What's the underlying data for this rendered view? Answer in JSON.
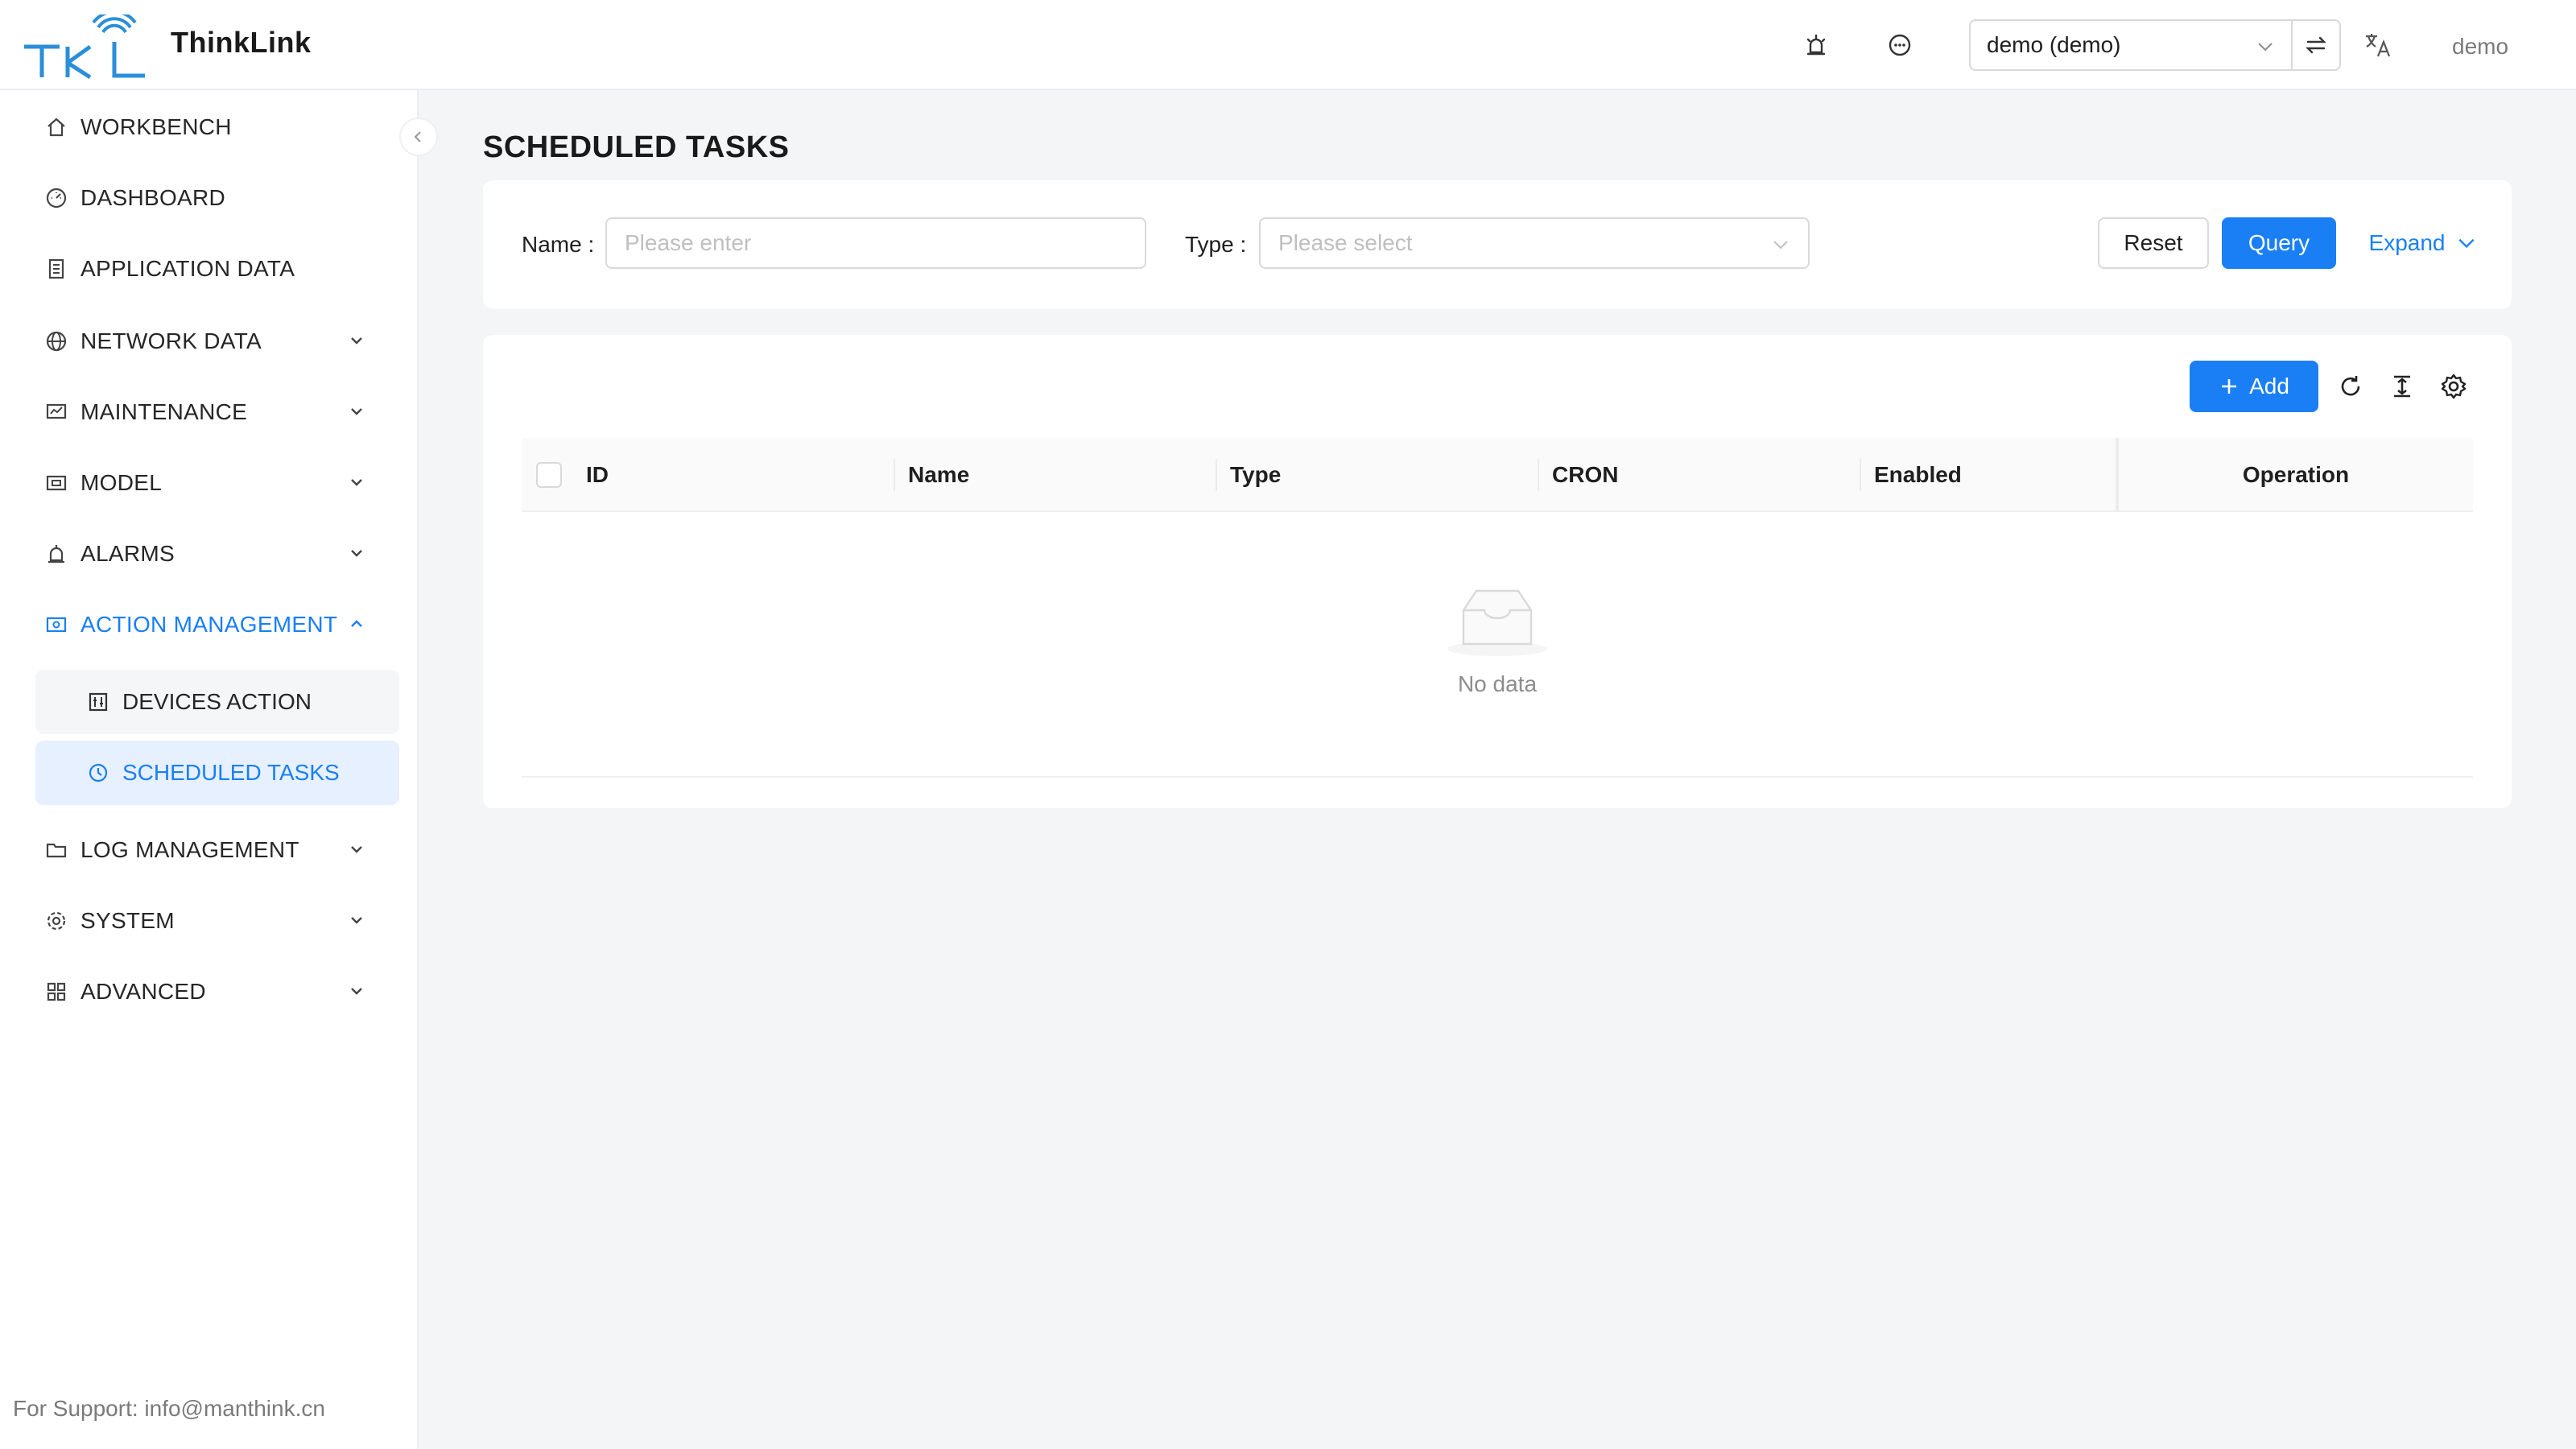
{
  "app": {
    "title": "ThinkLink",
    "user": "demo",
    "tenant": "demo (demo)",
    "support": "For Support: info@manthink.cn",
    "accent_color": "#1a7ff5"
  },
  "header": {
    "icons": [
      "alarm-icon",
      "message-icon",
      "switch-icon",
      "translate-icon"
    ]
  },
  "sidebar": {
    "items": [
      {
        "label": "WORKBENCH",
        "icon": "home-icon",
        "expandable": false
      },
      {
        "label": "DASHBOARD",
        "icon": "dashboard-icon",
        "expandable": false
      },
      {
        "label": "APPLICATION DATA",
        "icon": "document-icon",
        "expandable": false
      },
      {
        "label": "NETWORK DATA",
        "icon": "globe-icon",
        "expandable": true
      },
      {
        "label": "MAINTENANCE",
        "icon": "maintenance-icon",
        "expandable": true
      },
      {
        "label": "MODEL",
        "icon": "model-icon",
        "expandable": true
      },
      {
        "label": "ALARMS",
        "icon": "alarm-icon",
        "expandable": true
      },
      {
        "label": "ACTION MANAGEMENT",
        "icon": "action-icon",
        "expandable": true,
        "expanded": true
      },
      {
        "label": "LOG MANAGEMENT",
        "icon": "folder-icon",
        "expandable": true
      },
      {
        "label": "SYSTEM",
        "icon": "gear-icon",
        "expandable": true
      },
      {
        "label": "ADVANCED",
        "icon": "advanced-icon",
        "expandable": true
      }
    ],
    "sub_items": [
      {
        "label": "DEVICES ACTION",
        "icon": "device-action-icon",
        "selected": false
      },
      {
        "label": "SCHEDULED TASKS",
        "icon": "clock-icon",
        "selected": true
      }
    ]
  },
  "page": {
    "title": "SCHEDULED TASKS"
  },
  "search": {
    "name_label": "Name",
    "name_placeholder": "Please enter",
    "type_label": "Type",
    "type_placeholder": "Please select",
    "reset_label": "Reset",
    "query_label": "Query",
    "expand_label": "Expand"
  },
  "table": {
    "add_label": "Add",
    "columns": [
      "ID",
      "Name",
      "Type",
      "CRON",
      "Enabled",
      "Operation"
    ],
    "rows": [],
    "empty_text": "No data"
  }
}
